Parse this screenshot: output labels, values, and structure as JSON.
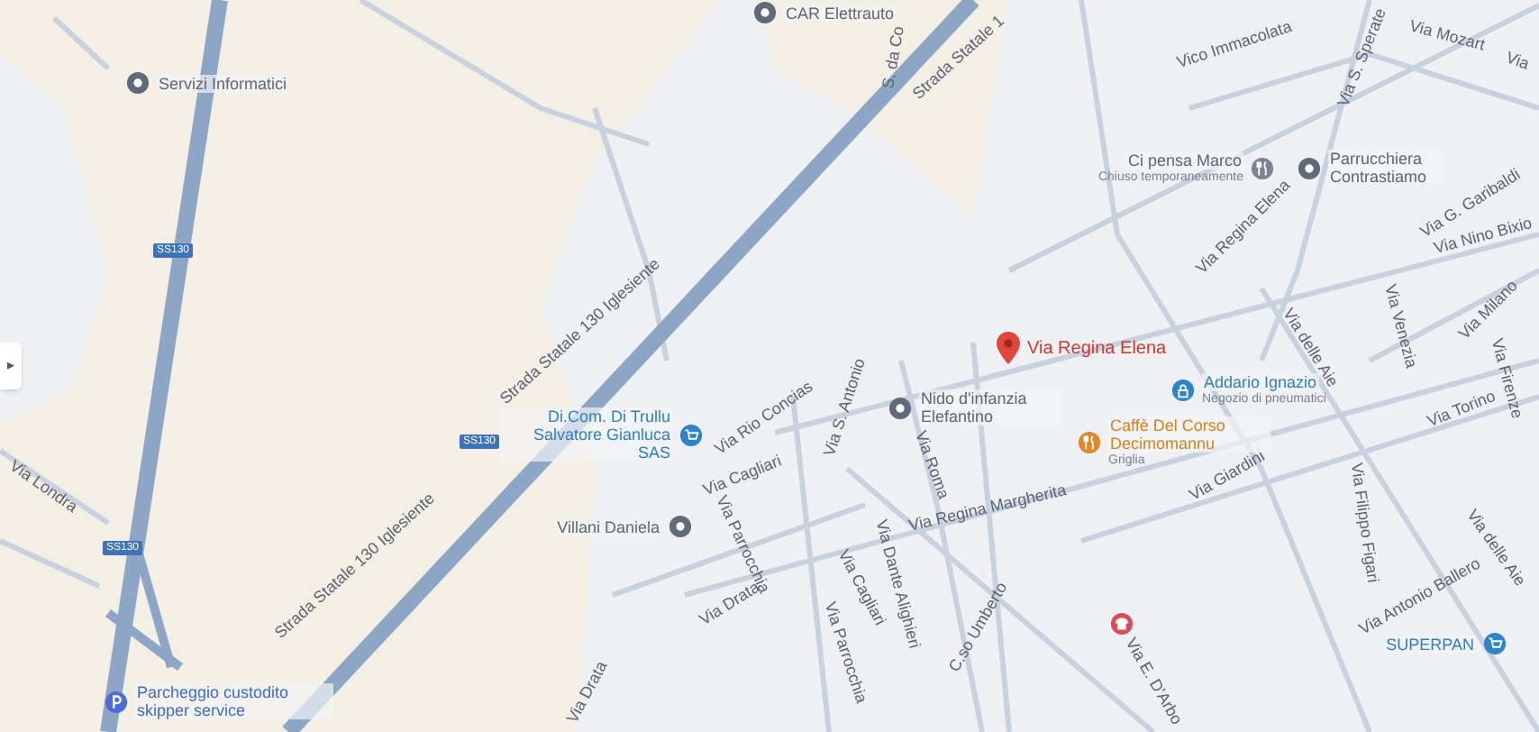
{
  "side_panel_toggle": {
    "icon": "▸"
  },
  "map": {
    "pin": {
      "label": "Via Regina Elena"
    },
    "places": [
      {
        "kind": "poi",
        "name": "CAR Elettrauto"
      },
      {
        "kind": "poi",
        "name": "Servizi Informatici"
      },
      {
        "kind": "food",
        "name": "Ci pensa Marco",
        "note": "Chiuso temporaneamente"
      },
      {
        "kind": "poi",
        "name": "Parrucchiera Contrastiamo"
      },
      {
        "kind": "shop",
        "name": "Addario Ignazio",
        "note": "Negozio di pneumatici"
      },
      {
        "kind": "poi",
        "name": "Nido d'infanzia Elefantino"
      },
      {
        "kind": "cart",
        "name": "Di.Com. Di Trullu Salvatore Gianluca SAS"
      },
      {
        "kind": "cafe",
        "name": "Caffè Del Corso Decimomannu",
        "note": "Griglia"
      },
      {
        "kind": "poi",
        "name": "Villani Daniela"
      },
      {
        "kind": "clothes"
      },
      {
        "kind": "cart",
        "name": "SUPERPAN"
      },
      {
        "kind": "parking",
        "name": "Parcheggio custodito skipper service"
      }
    ],
    "streets": [
      "Strada Statale 130 Iglesiente",
      "Strada Statale 130 Iglesiente",
      "Strada Statale 1",
      "S. da Co",
      "Vico Immacolata",
      "Via S. Sperate",
      "Via Mozart",
      "Via",
      "Via G. Garibaldi",
      "Via Nino Bixio",
      "Via Regina Elena",
      "Via Milano",
      "Via delle Aie",
      "Via Venezia",
      "Via Firenze",
      "Via Torino",
      "Via delle Aie",
      "Via Rio Concias",
      "Via S. Antonio",
      "Via Cagliari",
      "Via Cagliari",
      "Via Parrocchia",
      "Via Parrocchia",
      "Via Drata",
      "Via Drata",
      "Via Roma",
      "Via Regina Margherita",
      "Via Dante Alighieri",
      "C.so Umberto",
      "Via Giardini",
      "Via Filippo Figari",
      "Via Antonio Ballero",
      "Via E. D'Arbo",
      "Via Londra"
    ],
    "shields": [
      "SS130",
      "SS130",
      "SS130"
    ]
  }
}
